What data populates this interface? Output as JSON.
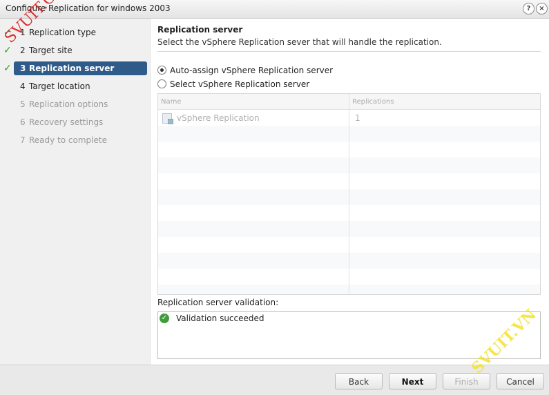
{
  "window": {
    "title": "Configure Replication for windows 2003"
  },
  "titlebar": {
    "help_glyph": "?",
    "close_glyph": "×"
  },
  "steps": [
    {
      "num": "1",
      "label": "Replication type",
      "state": "done"
    },
    {
      "num": "2",
      "label": "Target site",
      "state": "done"
    },
    {
      "num": "3",
      "label": "Replication server",
      "state": "active"
    },
    {
      "num": "4",
      "label": "Target location",
      "state": "enabled"
    },
    {
      "num": "5",
      "label": "Replication options",
      "state": "disabled"
    },
    {
      "num": "6",
      "label": "Recovery settings",
      "state": "disabled"
    },
    {
      "num": "7",
      "label": "Ready to complete",
      "state": "disabled"
    }
  ],
  "main": {
    "heading": "Replication server",
    "description": "Select the vSphere Replication sever that will handle the replication.",
    "radio_auto": "Auto-assign vSphere Replication server",
    "radio_select": "Select vSphere Replication server",
    "selected_radio": "auto",
    "grid": {
      "columns": [
        "Name",
        "Replications"
      ],
      "rows": [
        {
          "name": "vSphere Replication",
          "replications": "1"
        }
      ]
    },
    "validation_label": "Replication server validation:",
    "validation_message": "Validation succeeded"
  },
  "footer": {
    "back": "Back",
    "next": "Next",
    "finish": "Finish",
    "cancel": "Cancel"
  },
  "watermarks": {
    "left": "SVUIT.COM",
    "right": "SVUIT.VN"
  },
  "colors": {
    "active_step": "#2f5b8a",
    "check": "#3a9a1a",
    "success": "#3f9e3b"
  }
}
